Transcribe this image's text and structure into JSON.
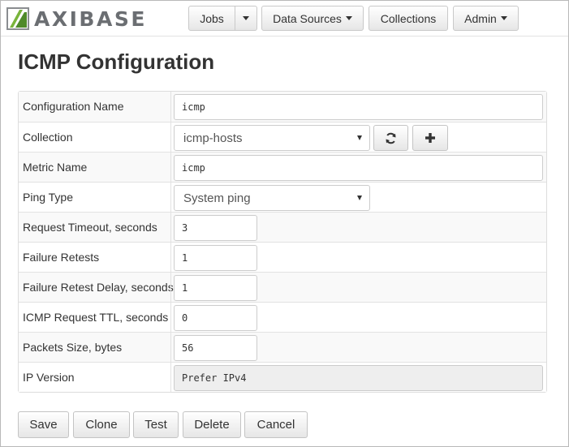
{
  "brand": {
    "logo_text": "AXIBASE"
  },
  "nav": {
    "jobs_label": "Jobs",
    "data_sources_label": "Data Sources",
    "collections_label": "Collections",
    "admin_label": "Admin"
  },
  "page": {
    "title": "ICMP Configuration"
  },
  "form": {
    "configuration_name": {
      "label": "Configuration Name",
      "value": "icmp"
    },
    "collection": {
      "label": "Collection",
      "selected": "icmp-hosts",
      "refresh_icon": "refresh-icon",
      "add_icon": "plus-icon"
    },
    "metric_name": {
      "label": "Metric Name",
      "value": "icmp"
    },
    "ping_type": {
      "label": "Ping Type",
      "selected": "System ping"
    },
    "request_timeout": {
      "label": "Request Timeout, seconds",
      "value": "3"
    },
    "failure_retests": {
      "label": "Failure Retests",
      "value": "1"
    },
    "failure_retest_delay": {
      "label": "Failure Retest Delay, seconds",
      "value": "1"
    },
    "icmp_request_ttl": {
      "label": "ICMP Request TTL, seconds",
      "value": "0"
    },
    "packets_size": {
      "label": "Packets Size, bytes",
      "value": "56"
    },
    "ip_version": {
      "label": "IP Version",
      "value": "Prefer IPv4"
    }
  },
  "actions": {
    "save_label": "Save",
    "clone_label": "Clone",
    "test_label": "Test",
    "delete_label": "Delete",
    "cancel_label": "Cancel"
  },
  "colors": {
    "logo_green": "#79b43b",
    "logo_gray": "#6b6e72",
    "border": "#cccccc",
    "readonly_bg": "#eeeeee"
  }
}
